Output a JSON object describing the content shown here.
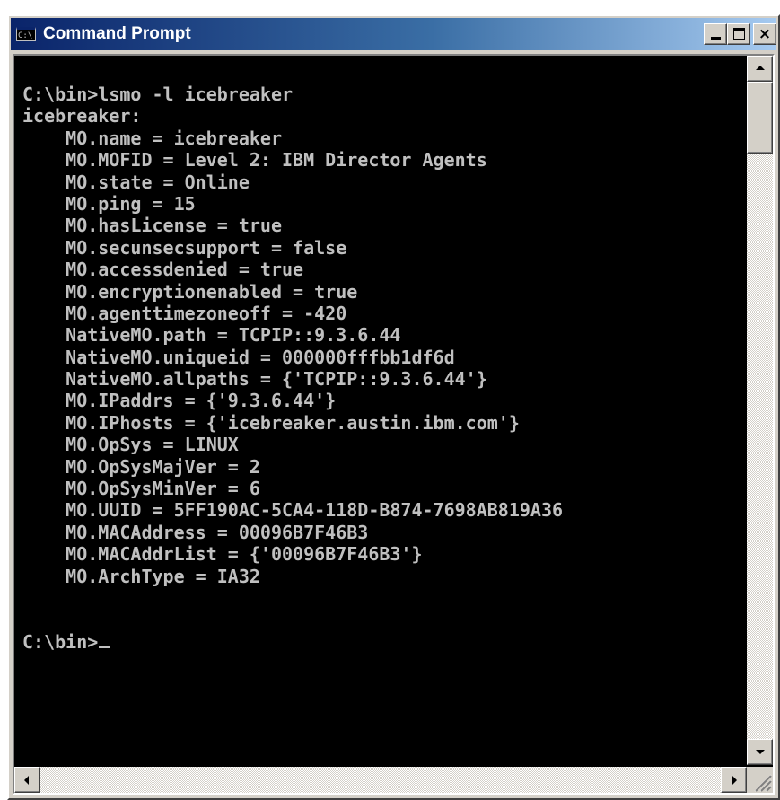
{
  "window": {
    "title": "Command Prompt",
    "icon": "console-icon",
    "icon_text": "C:\\"
  },
  "title_buttons": {
    "minimize_icon": "minimize-icon",
    "maximize_icon": "maximize-icon",
    "close_icon": "close-icon",
    "close_glyph": "×"
  },
  "console": {
    "lines": [
      "C:\\bin>lsmo -l icebreaker",
      "icebreaker:",
      "    MO.name = icebreaker",
      "    MO.MOFID = Level 2: IBM Director Agents",
      "    MO.state = Online",
      "    MO.ping = 15",
      "    MO.hasLicense = true",
      "    MO.secunsecsupport = false",
      "    MO.accessdenied = true",
      "    MO.encryptionenabled = true",
      "    MO.agenttimezoneoff = -420",
      "    NativeMO.path = TCPIP::9.3.6.44",
      "    NativeMO.uniqueid = 000000fffbb1df6d",
      "    NativeMO.allpaths = {'TCPIP::9.3.6.44'}",
      "    MO.IPaddrs = {'9.3.6.44'}",
      "    MO.IPhosts = {'icebreaker.austin.ibm.com'}",
      "    MO.OpSys = LINUX",
      "    MO.OpSysMajVer = 2",
      "    MO.OpSysMinVer = 6",
      "    MO.UUID = 5FF190AC-5CA4-118D-B874-7698AB819A36",
      "    MO.MACAddress = 00096B7F46B3",
      "    MO.MACAddrList = {'00096B7F46B3'}",
      "    MO.ArchType = IA32",
      "",
      "",
      "C:\\bin>"
    ],
    "colors": {
      "background": "#000000",
      "text": "#c0c0c0"
    }
  },
  "scrollbars": {
    "up_icon": "scroll-up-arrow-icon",
    "down_icon": "scroll-down-arrow-icon",
    "left_icon": "scroll-left-arrow-icon",
    "right_icon": "scroll-right-arrow-icon"
  },
  "colors": {
    "titlebar_start": "#0a246a",
    "titlebar_end": "#a6caf0",
    "chrome": "#d4d0c8"
  }
}
